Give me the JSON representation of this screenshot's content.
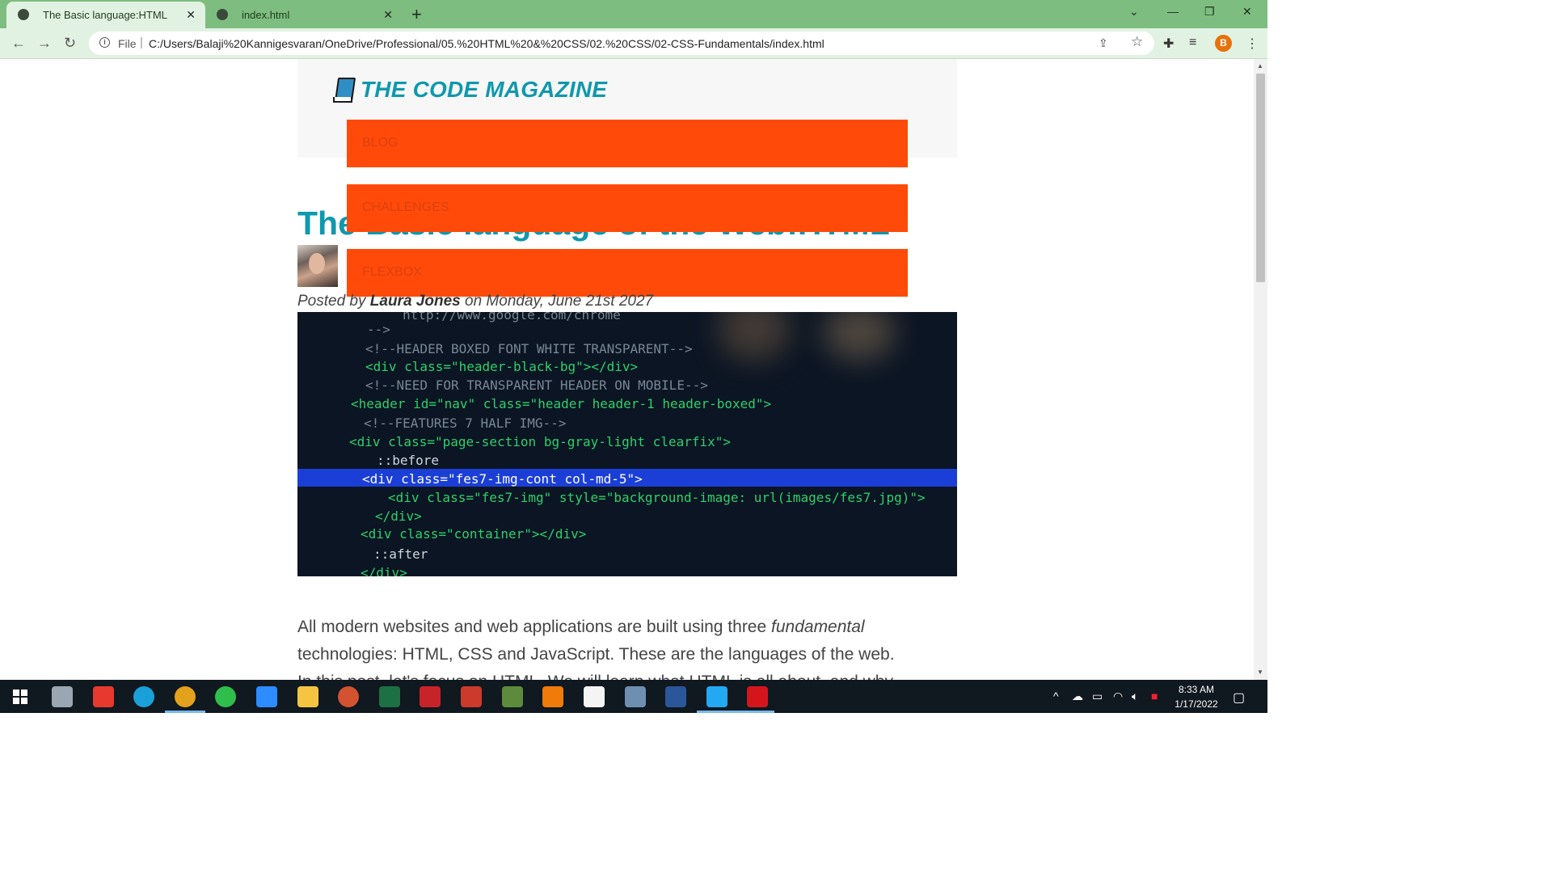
{
  "browser": {
    "tabs": [
      {
        "title": "The Basic language:HTML",
        "active": true
      },
      {
        "title": "index.html",
        "active": false
      }
    ],
    "address": {
      "scheme_label": "File",
      "url": "C:/Users/Balaji%20Kannigesvaran/OneDrive/Professional/05.%20HTML%20&%20CSS/02.%20CSS/02-CSS-Fundamentals/index.html"
    },
    "profile_initial": "B"
  },
  "page": {
    "logo_text": "THE CODE MAGAZINE",
    "nav": [
      "BLOG",
      "CHALLENGES",
      "FLEXBOX"
    ],
    "post_title": "The Basic language of the Web:HTML",
    "meta": {
      "prefix": "Posted by",
      "author": "Laura Jones",
      "middle": "on",
      "date": "Monday, June 21st 2027"
    },
    "paragraph_line1_a": "All modern websites and web applications are built using three ",
    "paragraph_line1_em": "fundamental",
    "paragraph_line2": "technologies: HTML, CSS and JavaScript. These are the languages of the web.",
    "paragraph_line3": "In this post, let's focus on HTML. We will learn what HTML is all about, and why",
    "hero_code": [
      "http://www.google.com/chrome",
      "-->",
      "<!--HEADER BOXED FONT WHITE TRANSPARENT-->",
      "<div class=\"header-black-bg\"></div>",
      "<!--NEED FOR TRANSPARENT HEADER ON MOBILE-->",
      "<header id=\"nav\" class=\"header header-1 header-boxed\">",
      "<!--FEATURES 7 HALF IMG-->",
      "<div class=\"page-section bg-gray-light clearfix\">",
      "::before",
      "<div class=\"fes7-img-cont col-md-5\">",
      "<div class=\"fes7-img\" style=\"background-image: url(images/fes7.jpg)\">",
      "</div>",
      "<div class=\"container\"></div>",
      "::after",
      "</div>"
    ]
  },
  "taskbar": {
    "time": "8:33 AM",
    "date": "1/17/2022",
    "apps": [
      "file-explorer-icon",
      "anydesk-icon",
      "edge-icon",
      "chrome-icon",
      "whatsapp-icon",
      "zoom-icon",
      "folder-icon",
      "powerpoint-icon",
      "excel-icon",
      "pdf-reader-icon",
      "et-app-icon",
      "tally-icon",
      "vlc-icon",
      "ws-app-icon",
      "remote-desktop-icon",
      "word-icon",
      "vscode-icon",
      "acrobat-icon"
    ]
  },
  "colors": {
    "accent": "#1098ad",
    "nav_bg": "#ff4a0a",
    "chrome_tabbar": "#7dbd7f",
    "chrome_toolbar": "#e2f2e2"
  }
}
